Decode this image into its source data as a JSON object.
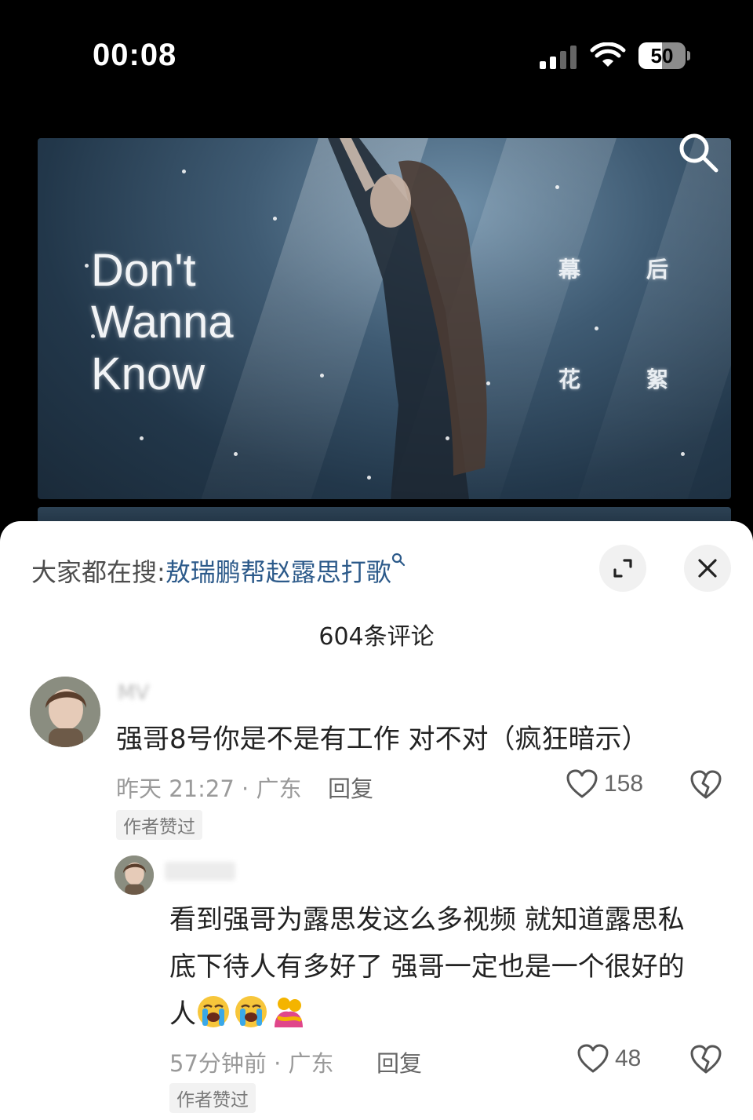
{
  "status_bar": {
    "time": "00:08",
    "battery": "50",
    "battery_level": 0.5
  },
  "video": {
    "title_lines": [
      "Don't",
      "Wanna",
      "Know"
    ],
    "caption_chars": [
      "幕",
      "后",
      "花",
      "絮"
    ]
  },
  "comments_sheet": {
    "trending_prefix": "大家都在搜:",
    "trending_query": "敖瑞鹏帮赵露思打歌",
    "comment_count": "604条评论",
    "comments": [
      {
        "username": "MV",
        "text": "强哥8号你是不是有工作 对不对（疯狂暗示）",
        "meta": "昨天 21:27 · 广东",
        "reply_label": "回复",
        "likes": "158",
        "badge": "作者赞过"
      },
      {
        "username": "",
        "text_lines": [
          "看到强哥为露思发这么多视频 就知道露思私",
          "底下待人有多好了 强哥一定也是一个很好的",
          "人"
        ],
        "emojis": [
          "loudly-crying-face",
          "loudly-crying-face",
          "people-hugging"
        ],
        "meta": "57分钟前 · 广东",
        "reply_label": "回复",
        "likes": "48",
        "badge": "作者赞过"
      }
    ]
  }
}
